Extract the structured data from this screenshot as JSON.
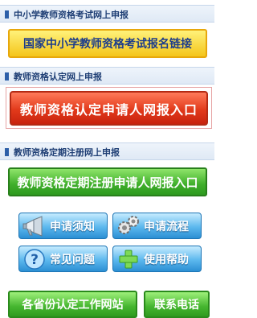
{
  "sections": [
    {
      "header": "中小学教师资格考试网上申报",
      "button": "国家中小学教师资格考试报名链接"
    },
    {
      "header": "教师资格认定网上申报",
      "button": "教师资格认定申请人网报入口"
    },
    {
      "header": "教师资格定期注册网上申报",
      "button": "教师资格定期注册申请人网报入口"
    }
  ],
  "quick_links": [
    {
      "label": "申请须知",
      "icon": "megaphone-icon"
    },
    {
      "label": "申请流程",
      "icon": "gears-icon"
    },
    {
      "label": "常见问题",
      "icon": "question-icon"
    },
    {
      "label": "使用帮助",
      "icon": "help-plus-icon"
    }
  ],
  "bottom": {
    "provinces": "各省份认定工作网站",
    "phone": "联系电话"
  }
}
